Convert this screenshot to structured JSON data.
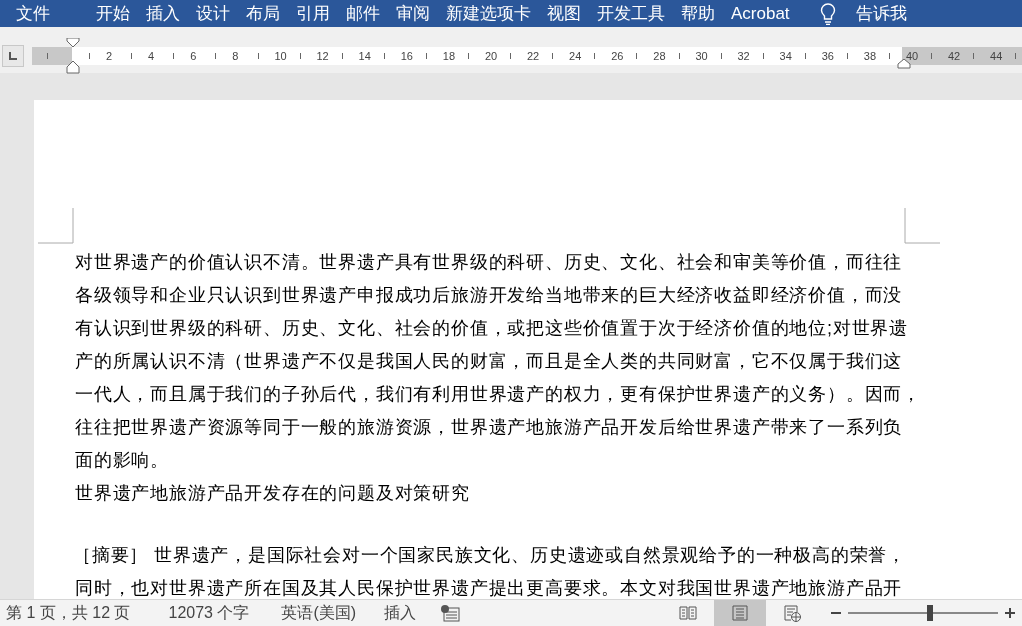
{
  "ribbon_tabs": [
    {
      "label": "文件",
      "selected": false
    },
    {
      "label": "开始",
      "selected": false
    },
    {
      "label": "插入",
      "selected": false
    },
    {
      "label": "设计",
      "selected": false
    },
    {
      "label": "布局",
      "selected": false
    },
    {
      "label": "引用",
      "selected": false
    },
    {
      "label": "邮件",
      "selected": false
    },
    {
      "label": "审阅",
      "selected": false
    },
    {
      "label": "新建选项卡",
      "selected": false
    },
    {
      "label": "视图",
      "selected": false
    },
    {
      "label": "开发工具",
      "selected": false
    },
    {
      "label": "帮助",
      "selected": false
    },
    {
      "label": "Acrobat",
      "selected": false
    }
  ],
  "tell_me": "告诉我",
  "ruler": {
    "labels": [
      "2",
      "4",
      "6",
      "8",
      "10",
      "12",
      "14",
      "16",
      "18",
      "20",
      "22",
      "24",
      "26",
      "28",
      "30",
      "32",
      "34",
      "36",
      "38",
      "40",
      "42",
      "44"
    ]
  },
  "document": {
    "paragraph_lines": [
      "对世界遗产的价值认识不清。世界遗产具有世界级的科研、历史、文化、社会和审美等价值，而往往",
      "各级领导和企业只认识到世界遗产申报成功后旅游开发给当地带来的巨大经济收益即经济价值，而没",
      "有认识到世界级的科研、历史、文化、社会的价值，或把这些价值置于次于经济价值的地位;对世界遗",
      "产的所属认识不清（世界遗产不仅是我国人民的财富，而且是全人类的共同财富，它不仅属于我们这",
      "一代人，而且属于我们的子孙后代，我们有利用世界遗产的权力，更有保护世界遗产的义务）。因而，",
      "往往把世界遗产资源等同于一般的旅游资源，世界遗产地旅游产品开发后给世界遗产带来了一系列负",
      "面的影响。"
    ],
    "heading": "世界遗产地旅游产品开发存在的问题及对策研究",
    "abstract_lines": [
      "［摘要］ 世界遗产，是国际社会对一个国家民族文化、历史遗迹或自然景观给予的一种极高的荣誉，",
      "同时，也对世界遗产所在国及其人民保护世界遗产提出更高要求。本文对我国世界遗产地旅游产品开"
    ]
  },
  "status_bar": {
    "page": "第 1 页，共 12 页",
    "words": "12073 个字",
    "language": "英语(美国)",
    "mode": "插入",
    "views": [
      {
        "kind": "read",
        "selected": false
      },
      {
        "kind": "print",
        "selected": true
      },
      {
        "kind": "web",
        "selected": false
      }
    ],
    "zoom": {
      "level": 0.55
    }
  }
}
